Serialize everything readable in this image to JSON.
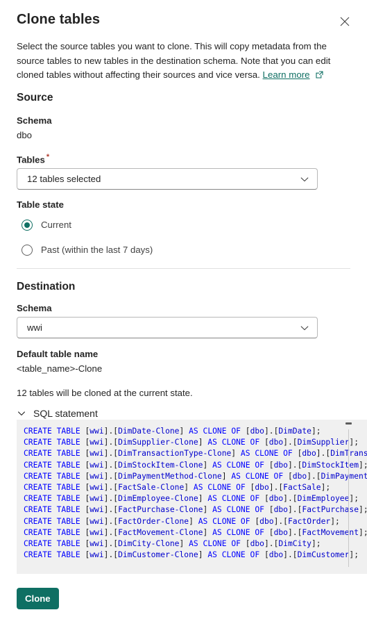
{
  "dialog": {
    "title": "Clone tables",
    "close_icon": "close-icon",
    "description_part1": "Select the source tables you want to clone. This will copy metadata from the source tables to new tables in the destination schema. Note that you can edit cloned tables without affecting their sources and vice versa. ",
    "learn_more_label": "Learn more",
    "external_link_icon": "external-link-icon"
  },
  "source": {
    "heading": "Source",
    "schema_label": "Schema",
    "schema_value": "dbo",
    "tables_label": "Tables",
    "tables_required_marker": "*",
    "tables_selected_text": "12 tables selected",
    "table_state_label": "Table state",
    "options": [
      {
        "label": "Current",
        "selected": true
      },
      {
        "label": "Past (within the last 7 days)",
        "selected": false
      }
    ]
  },
  "destination": {
    "heading": "Destination",
    "schema_label": "Schema",
    "schema_value": "wwi",
    "default_table_name_label": "Default table name",
    "default_table_name_value": "<table_name>-Clone",
    "note": "12 tables will be cloned at the current state."
  },
  "sql": {
    "toggle_label": "SQL statement",
    "toggle_state": "expanded",
    "lines": [
      {
        "dest": "DimDate-Clone",
        "src": "DimDate"
      },
      {
        "dest": "DimSupplier-Clone",
        "src": "DimSupplier"
      },
      {
        "dest": "DimTransactionType-Clone",
        "src": "DimTransactionType"
      },
      {
        "dest": "DimStockItem-Clone",
        "src": "DimStockItem"
      },
      {
        "dest": "DimPaymentMethod-Clone",
        "src": "DimPaymentMethod"
      },
      {
        "dest": "FactSale-Clone",
        "src": "FactSale"
      },
      {
        "dest": "DimEmployee-Clone",
        "src": "DimEmployee"
      },
      {
        "dest": "FactPurchase-Clone",
        "src": "FactPurchase"
      },
      {
        "dest": "FactOrder-Clone",
        "src": "FactOrder"
      },
      {
        "dest": "FactMovement-Clone",
        "src": "FactMovement"
      },
      {
        "dest": "DimCity-Clone",
        "src": "DimCity"
      },
      {
        "dest": "DimCustomer-Clone",
        "src": "DimCustomer"
      }
    ],
    "dest_schema": "wwi",
    "src_schema": "dbo",
    "keyword_create": "CREATE",
    "keyword_table": "TABLE",
    "keyword_as": "AS",
    "keyword_clone": "CLONE",
    "keyword_of": "OF"
  },
  "actions": {
    "primary_label": "Clone"
  },
  "colors": {
    "accent": "#0f6f63",
    "link": "#0f6f63",
    "required": "#b03b2e",
    "sql_keyword": "#0000ff",
    "sql_identifier": "#0000cd",
    "sql_background": "#f0f0f0",
    "text": "#242424"
  }
}
